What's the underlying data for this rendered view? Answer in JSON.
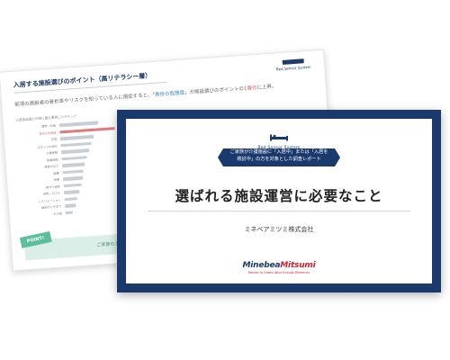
{
  "back_slide": {
    "title": "入居する施設選びのポイント（高リテラシー層）",
    "logo_text": "Bed Sensor System",
    "body_prefix": "前項の高齢者の骨折率やリスクを知っている人に限定すると、",
    "body_highlight": "「骨折の危険度」",
    "body_middle": "が施設選びのポイントの",
    "body_highlight2": "1番目",
    "body_suffix": "に上昇。",
    "chart_caption": "入居施設選びの際に最も重視したポイント",
    "chart_rows": [
      {
        "label": "費用・料金",
        "value": 0.55,
        "highlight": false
      },
      {
        "label": "骨折の危険度",
        "value": 0.78,
        "highlight": true
      },
      {
        "label": "立地",
        "value": 0.48,
        "highlight": false
      },
      {
        "label": "スタッフの対応",
        "value": 0.44,
        "highlight": false
      },
      {
        "label": "介護体制",
        "value": 0.4,
        "highlight": false
      },
      {
        "label": "医療体制",
        "value": 0.36,
        "highlight": false
      },
      {
        "label": "居室の広さ",
        "value": 0.32,
        "highlight": false
      },
      {
        "label": "設備",
        "value": 0.3,
        "highlight": false
      },
      {
        "label": "食事",
        "value": 0.28,
        "highlight": false
      },
      {
        "label": "見守り体制",
        "value": 0.25,
        "highlight": false
      },
      {
        "label": "評判・口コミ",
        "value": 0.22,
        "highlight": false
      },
      {
        "label": "レクリエーション",
        "value": 0.18,
        "highlight": false
      },
      {
        "label": "面会のしやすさ",
        "value": 0.15,
        "highlight": false
      },
      {
        "label": "その他",
        "value": 0.1,
        "highlight": false
      }
    ],
    "point_badge": "POINT!",
    "point_text": "ご家族の入居を検討している方へ"
  },
  "front_slide": {
    "logo_text": "Bed Sensor System",
    "ribbon_line1": "ご家族が介護施設に「入居中」または「入居を",
    "ribbon_line2": "検討中」の方を対象とした調査レポート",
    "title": "選ばれる施設運営に必要なこと",
    "company": "ミネベアミツミ株式会社",
    "brand_part1": "Minebea",
    "brand_part2": "Mitsumi",
    "tagline": "Passion to Create Value through Difference"
  },
  "colors": {
    "navy": "#1a3a6e",
    "brand_red": "#d11f2d",
    "highlight_red": "#e07b7b",
    "point_green": "#5bbf9c"
  }
}
